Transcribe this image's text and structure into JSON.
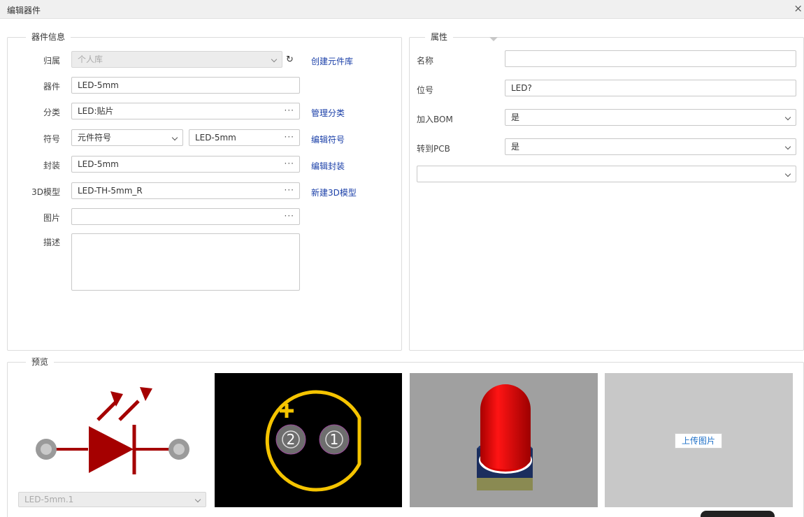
{
  "window": {
    "title": "编辑器件",
    "close_glyph": "×"
  },
  "info": {
    "legend": "器件信息",
    "library": {
      "label": "归属",
      "value": "个人库",
      "link": "创建元件库"
    },
    "device": {
      "label": "器件",
      "value": "LED-5mm"
    },
    "category": {
      "label": "分类",
      "value": "LED:贴片",
      "link": "管理分类"
    },
    "symbol": {
      "label": "符号",
      "type_value": "元件符号",
      "value": "LED-5mm",
      "link": "编辑符号"
    },
    "footprint": {
      "label": "封装",
      "value": "LED-5mm",
      "link": "编辑封装"
    },
    "model3d": {
      "label": "3D模型",
      "value": "LED-TH-5mm_R",
      "link": "新建3D模型"
    },
    "image": {
      "label": "图片",
      "value": ""
    },
    "description": {
      "label": "描述",
      "value": ""
    },
    "dots": "···"
  },
  "attributes": {
    "legend": "属性",
    "name": {
      "label": "名称",
      "value": ""
    },
    "designator": {
      "label": "位号",
      "value": "LED?"
    },
    "add_bom": {
      "label": "加入BOM",
      "value": "是"
    },
    "to_pcb": {
      "label": "转到PCB",
      "value": "是"
    },
    "extra": {
      "value": ""
    }
  },
  "preview": {
    "legend": "预览",
    "symbol_select": "LED-5mm.1",
    "footprint_pins": [
      "2",
      "1"
    ],
    "upload_label": "上传图片"
  },
  "colors": {
    "symbol_red": "#a50000",
    "footprint_yellow": "#f5c400",
    "link_blue": "#1a3fa8",
    "led_red": "#e40000"
  }
}
